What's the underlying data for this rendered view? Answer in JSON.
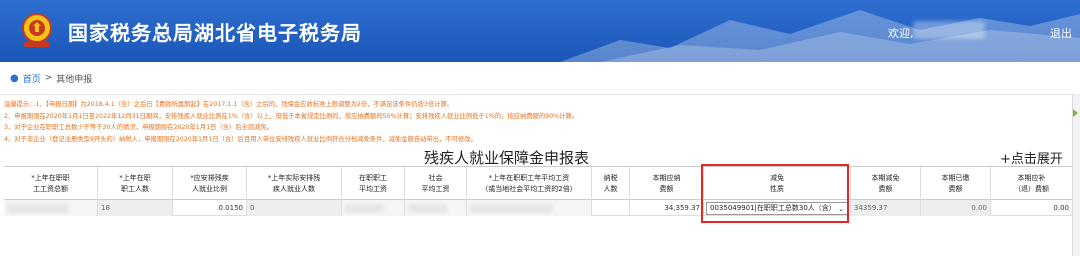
{
  "header": {
    "site_title": "国家税务总局湖北省电子税务局",
    "welcome_prefix": "欢迎,",
    "logout_label": "退出",
    "brand_color": "#1a56b8"
  },
  "breadcrumb": {
    "icon": "location-pin-icon",
    "home": "首页",
    "separator": ">",
    "current": "其他申报"
  },
  "notice": [
    "温馨提示：1、【申报日期】为2018.4.1（含）之后日【费款所属期起】在2017.1.1（含）之后的，残保金应收标准上限调整为2倍，不满足该条件仍按3倍计算。",
    "2、申报期限在2020年1月1日至2022年12月31日期间，安排残疾人就业比例在1%（含）以上，但低于本省规定比例的，按应纳费额的50%计算；安排残疾人就业比例低于1%的，按应纳费额的90%计算。",
    "3、对于企业在职职工总数少于等于30人的情况，申报期限在2020年1月1日（含）后全部减免。",
    "4、对于非企业（登记注册类型9开头的）纳税人，申报期限在2020年1月1日（含）后且用人单位安排残疾人就业比例符合分档减免条件，减免金额自动带出，不可修改。"
  ],
  "form": {
    "title": "残疾人就业保障金申报表",
    "expand_label": "+点击展开"
  },
  "table": {
    "headers": [
      [
        "*上年在职职",
        "工工资总额"
      ],
      [
        "*上年在职",
        "职工人数"
      ],
      [
        "*应安排残疾",
        "人就业比例"
      ],
      [
        "*上年实际安排残",
        "疾人就业人数"
      ],
      [
        "在职职工",
        "平均工资"
      ],
      [
        "社会",
        "平均工资"
      ],
      [
        "*上年在职职工年平均工资",
        "（或当地社会平均工资的2倍）"
      ],
      [
        "纳税",
        "人数"
      ],
      [
        "本期应纳",
        "费额"
      ],
      [
        "减免",
        "性质"
      ],
      [
        "本期减免",
        "费额"
      ],
      [
        "本期已缴",
        "费额"
      ],
      [
        "本期应补",
        "（退）费额"
      ]
    ],
    "row": {
      "employees": "18",
      "ratio": "0.0150",
      "disabled_count": "0",
      "payable": "34,359.37",
      "exemption": "0035049901|在职职工总数30人（含）",
      "reduction": "34359.37",
      "paid": "0.00",
      "due": "0.00"
    }
  },
  "colors": {
    "notice_text": "#e8701a",
    "highlight": "#e32626"
  }
}
